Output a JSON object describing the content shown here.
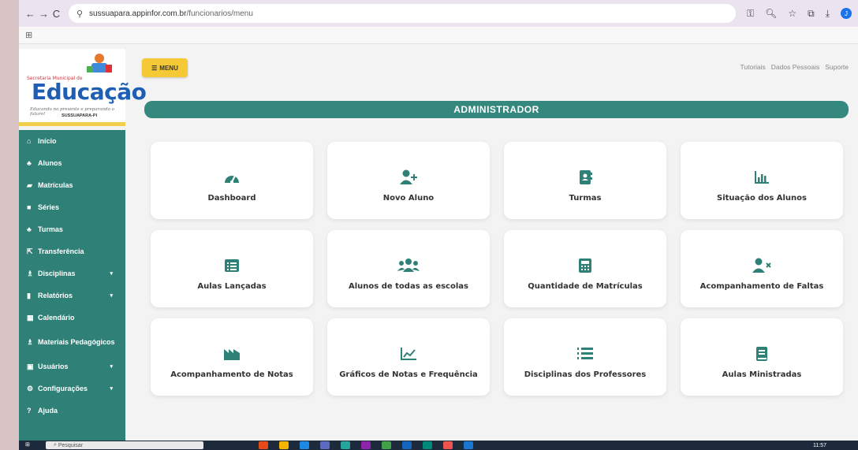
{
  "browser": {
    "url_host": "sussuapara.appinfor.com.br",
    "url_path": "/funcionarios/menu",
    "nav_back": "←",
    "nav_forward": "→",
    "nav_reload": "C",
    "apps_grid": "⊞"
  },
  "app": {
    "logo": {
      "small_text": "Secretaria Municipal de",
      "title": "Educação",
      "tagline": "Educando no presente e preparando o futuro!",
      "city": "SUSSUAPARA-PI"
    },
    "menu_button": "MENU",
    "top_links": [
      "Tutoriais",
      "Dados Pessoais",
      "Suporte"
    ],
    "admin_title": "ADMINISTRADOR",
    "sidebar": [
      {
        "label": "Início",
        "icon": "home-icon",
        "caret": false
      },
      {
        "label": "Alunos",
        "icon": "users-icon",
        "caret": false
      },
      {
        "label": "Matrículas",
        "icon": "graduation-icon",
        "caret": false
      },
      {
        "label": "Séries",
        "icon": "list-icon",
        "caret": false
      },
      {
        "label": "Turmas",
        "icon": "users-icon",
        "caret": false
      },
      {
        "label": "Transferência",
        "icon": "external-icon",
        "caret": false
      },
      {
        "label": "Disciplinas",
        "icon": "sitemap-icon",
        "caret": true
      },
      {
        "label": "Relatórios",
        "icon": "book-icon",
        "caret": true
      },
      {
        "label": "Calendário",
        "icon": "calendar-icon",
        "caret": false
      },
      {
        "label": "Materiais Pedagógicos",
        "icon": "sitemap-icon",
        "caret": false
      },
      {
        "label": "Usuários",
        "icon": "user-icon",
        "caret": true
      },
      {
        "label": "Configurações",
        "icon": "gear-icon",
        "caret": true
      },
      {
        "label": "Ajuda",
        "icon": "help-icon",
        "caret": false
      }
    ],
    "cards": [
      {
        "label": "Dashboard",
        "icon": "gauge-icon"
      },
      {
        "label": "Novo Aluno",
        "icon": "user-plus-icon"
      },
      {
        "label": "Turmas",
        "icon": "address-book-icon"
      },
      {
        "label": "Situação dos Alunos",
        "icon": "bar-chart-icon"
      },
      {
        "label": "Aulas Lançadas",
        "icon": "list-alt-icon"
      },
      {
        "label": "Alunos de todas as escolas",
        "icon": "users-group-icon"
      },
      {
        "label": "Quantidade de Matrículas",
        "icon": "calculator-icon"
      },
      {
        "label": "Acompanhamento de Faltas",
        "icon": "user-times-icon"
      },
      {
        "label": "Acompanhamento de Notas",
        "icon": "industry-chart-icon"
      },
      {
        "label": "Gráficos de Notas e Frequência",
        "icon": "line-chart-icon"
      },
      {
        "label": "Disciplinas dos Professores",
        "icon": "ordered-list-icon"
      },
      {
        "label": "Aulas Ministradas",
        "icon": "book-icon"
      }
    ],
    "accent": "#2f8177",
    "menu_color": "#f5c936"
  },
  "taskbar": {
    "search_placeholder": "Pesquisar",
    "clock": "11:57"
  }
}
